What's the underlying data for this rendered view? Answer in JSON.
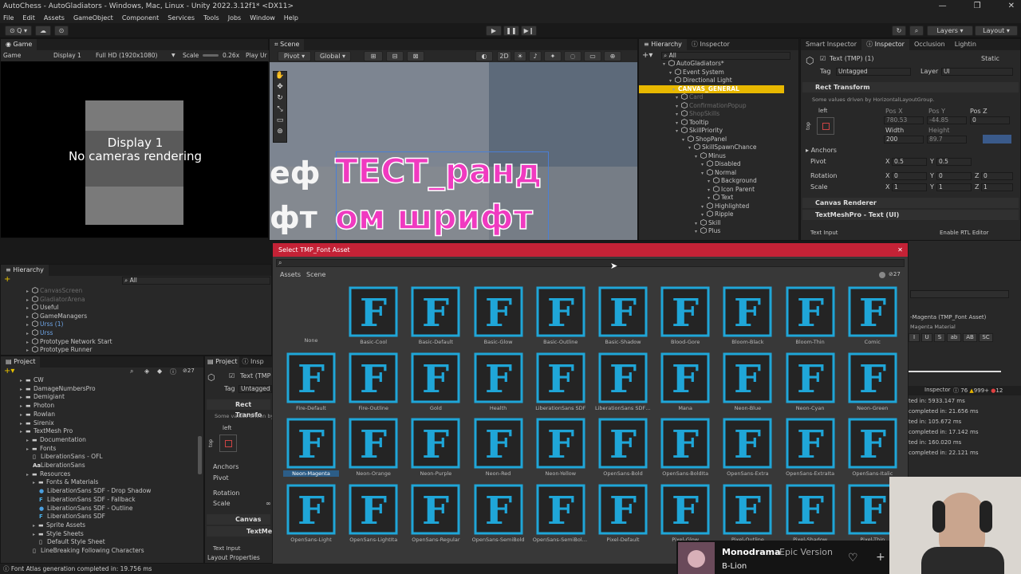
{
  "window": {
    "title": "AutoChess - AutoGladiators - Windows, Mac, Linux - Unity 2022.3.12f1* <DX11>",
    "menu": [
      "File",
      "Edit",
      "Assets",
      "GameObject",
      "Component",
      "Services",
      "Tools",
      "Jobs",
      "Window",
      "Help"
    ]
  },
  "toolbar": {
    "layers_label": "Layers",
    "layout_label": "Layout"
  },
  "game_view": {
    "tab": "Game",
    "mode": "Game",
    "display": "Display 1",
    "resolution": "Full HD (1920x1080)",
    "scale_label": "Scale",
    "scale_value": "0.26x",
    "play_label": "Play Ur",
    "overlay_line1": "Display 1",
    "overlay_line2": "No cameras rendering"
  },
  "scene_view": {
    "tab": "Scene",
    "pivot": "Pivot",
    "global": "Global",
    "mode_2d": "2D",
    "text_main_1": "ТЕСТ_ранд",
    "text_main_2": "ом шрифт",
    "text_left_1": "еф",
    "text_left_2": "фт"
  },
  "hierarchy_top": {
    "tabs": [
      "Hierarchy",
      "Inspector"
    ],
    "search_placeholder": "All",
    "items": [
      {
        "label": "AutoGladiators*",
        "indent": 0,
        "style": "normal"
      },
      {
        "label": "Event System",
        "indent": 1,
        "style": "normal"
      },
      {
        "label": "Directional Light",
        "indent": 1,
        "style": "normal"
      },
      {
        "label": "CANVAS_GENERAL",
        "indent": 1,
        "style": "highlight"
      },
      {
        "label": "Card",
        "indent": 2,
        "style": "dim"
      },
      {
        "label": "ConfirmationPopup",
        "indent": 2,
        "style": "dim"
      },
      {
        "label": "ShopSkills",
        "indent": 2,
        "style": "dim"
      },
      {
        "label": "Tooltip",
        "indent": 2,
        "style": "normal"
      },
      {
        "label": "SkillPriority",
        "indent": 2,
        "style": "normal"
      },
      {
        "label": "ShopPanel",
        "indent": 3,
        "style": "normal"
      },
      {
        "label": "SkillSpawnChance",
        "indent": 4,
        "style": "normal"
      },
      {
        "label": "Minus",
        "indent": 5,
        "style": "normal"
      },
      {
        "label": "Disabled",
        "indent": 6,
        "style": "normal"
      },
      {
        "label": "Normal",
        "indent": 6,
        "style": "normal"
      },
      {
        "label": "Background",
        "indent": 7,
        "style": "normal"
      },
      {
        "label": "Icon Parent",
        "indent": 7,
        "style": "normal"
      },
      {
        "label": "Text",
        "indent": 7,
        "style": "normal"
      },
      {
        "label": "Highlighted",
        "indent": 6,
        "style": "normal"
      },
      {
        "label": "Ripple",
        "indent": 6,
        "style": "normal"
      },
      {
        "label": "Skill",
        "indent": 5,
        "style": "normal"
      },
      {
        "label": "Plus",
        "indent": 5,
        "style": "normal"
      }
    ]
  },
  "inspector_right": {
    "tabs": [
      "Smart Inspector",
      "Inspector",
      "Occlusion",
      "Lightin"
    ],
    "object_name": "Text (TMP) (1)",
    "static_label": "Static",
    "tag_label": "Tag",
    "tag_value": "Untagged",
    "layer_label": "Layer",
    "layer_value": "UI",
    "rect_transform": "Rect Transform",
    "driven_note": "Some values driven by HorizontalLayoutGroup.",
    "left_label": "left",
    "top_label": "top",
    "posx_label": "Pos X",
    "posy_label": "Pos Y",
    "posz_label": "Pos Z",
    "posx": "780.53",
    "posy": "-44.85",
    "posz": "0",
    "width_label": "Width",
    "height_label": "Height",
    "width": "200",
    "height": "89.7",
    "anchors": "Anchors",
    "pivot": "Pivot",
    "pivot_x": "0.5",
    "pivot_y": "0.5",
    "rotation": "Rotation",
    "rot_x": "0",
    "rot_y": "0",
    "rot_z": "0",
    "scale": "Scale",
    "scale_x": "1",
    "scale_y": "1",
    "scale_z": "1",
    "canvas_renderer": "Canvas Renderer",
    "tmp_component": "TextMeshPro - Text (UI)",
    "text_input": "Text Input",
    "rtl": "Enable RTL Editor",
    "material_line1": "-Magenta (TMP_Font Asset)",
    "material_line2": "Magenta Material",
    "style_buttons": [
      "I",
      "U",
      "S",
      "ab",
      "AB",
      "SC"
    ]
  },
  "console": {
    "tab": "Inspector",
    "warn_count": "76",
    "err_count": "999+",
    "info_count": "12",
    "lines": [
      "ted in: 5933.147 ms",
      "completed in: 21.656 ms",
      "ted in: 105.672 ms",
      "completed in: 17.142 ms",
      "ted in: 160.020 ms",
      "completed in: 22.121 ms"
    ]
  },
  "hierarchy_left": {
    "tab": "Hierarchy",
    "search_placeholder": "All",
    "items": [
      {
        "label": "CanvasScreen",
        "style": "dim"
      },
      {
        "label": "GladiatorArena",
        "style": "dim"
      },
      {
        "label": "Useful",
        "style": "normal"
      },
      {
        "label": "GameManagers",
        "style": "normal"
      },
      {
        "label": "Urss (1)",
        "style": "blue"
      },
      {
        "label": "Urss",
        "style": "blue"
      },
      {
        "label": "Prototype Network Start",
        "style": "normal"
      },
      {
        "label": "Prototype Runner",
        "style": "normal"
      }
    ]
  },
  "project": {
    "tabs": [
      "Project",
      "Insp"
    ],
    "badge": "27",
    "items": [
      {
        "label": "CW",
        "indent": 1,
        "kind": "folder"
      },
      {
        "label": "DamageNumbersPro",
        "indent": 1,
        "kind": "folder"
      },
      {
        "label": "Demigiant",
        "indent": 1,
        "kind": "folder"
      },
      {
        "label": "Photon",
        "indent": 1,
        "kind": "folder"
      },
      {
        "label": "Rowlan",
        "indent": 1,
        "kind": "folder"
      },
      {
        "label": "Sirenix",
        "indent": 1,
        "kind": "folder"
      },
      {
        "label": "TextMesh Pro",
        "indent": 1,
        "kind": "folder"
      },
      {
        "label": "Documentation",
        "indent": 2,
        "kind": "folder"
      },
      {
        "label": "Fonts",
        "indent": 2,
        "kind": "folder"
      },
      {
        "label": "LiberationSans - OFL",
        "indent": 3,
        "kind": "file"
      },
      {
        "label": "LiberationSans",
        "indent": 3,
        "kind": "font"
      },
      {
        "label": "Resources",
        "indent": 2,
        "kind": "folder"
      },
      {
        "label": "Fonts & Materials",
        "indent": 3,
        "kind": "folder"
      },
      {
        "label": "LiberationSans SDF - Drop Shadow",
        "indent": 4,
        "kind": "mat"
      },
      {
        "label": "LiberationSans SDF - Fallback",
        "indent": 4,
        "kind": "fasset"
      },
      {
        "label": "LiberationSans SDF - Outline",
        "indent": 4,
        "kind": "mat"
      },
      {
        "label": "LiberationSans SDF",
        "indent": 4,
        "kind": "fasset"
      },
      {
        "label": "Sprite Assets",
        "indent": 3,
        "kind": "folder"
      },
      {
        "label": "Style Sheets",
        "indent": 3,
        "kind": "folder"
      },
      {
        "label": "Default Style Sheet",
        "indent": 4,
        "kind": "file"
      },
      {
        "label": "LineBreaking Following Characters",
        "indent": 3,
        "kind": "file"
      }
    ]
  },
  "inspector_mini": {
    "object_name": "Text (TMP",
    "tag_label": "Tag",
    "tag_value": "Untagged",
    "rect": "Rect Transfo",
    "driven": "Some values driven by",
    "left": "left",
    "top": "top",
    "anchors": "Anchors",
    "pivot": "Pivot",
    "rotation": "Rotation",
    "scale": "Scale",
    "canvas": "Canvas Rend",
    "tmp": "TextMeshPr",
    "text_input": "Text Input",
    "layout_props": "Layout Properties"
  },
  "picker": {
    "title": "Select TMP_Font Asset",
    "tabs": [
      "Assets",
      "Scene"
    ],
    "count": "27",
    "none_label": "None",
    "fonts": [
      "Basic-Cool",
      "Basic-Default",
      "Basic-Glow",
      "Basic-Outline",
      "Basic-Shadow",
      "Blood-Gore",
      "Bloom-Black",
      "Bloom-Thin",
      "Comic",
      "Fire-Default",
      "Fire-Outline",
      "Gold",
      "Health",
      "LiberationSans SDF",
      "LiberationSans SDF - Fallback",
      "Mana",
      "Neon-Blue",
      "Neon-Cyan",
      "Neon-Green",
      "Neon-Magenta",
      "Neon-Orange",
      "Neon-Purple",
      "Neon-Red",
      "Neon-Yellow",
      "OpenSans-Bold",
      "OpenSans-BoldIta",
      "OpenSans-Extra",
      "OpenSans-ExtraIta",
      "OpenSans-Italic",
      "OpenSans-Light",
      "OpenSans-LightIta",
      "OpenSans-Regular",
      "OpenSans-SemiBold",
      "OpenSans-SemiBoldIta",
      "Pixel-Default",
      "Pixel-Glow",
      "Pixel-Outline",
      "Pixel-Shadow",
      "Pixel-Thin"
    ],
    "selected": "Neon-Magenta",
    "icon_color": "#1fa6d8"
  },
  "status_bar": {
    "text": "Font Atlas generation completed in: 19.756 ms"
  },
  "music": {
    "title": "Monodrama",
    "subtitle": "Epic Version",
    "artist": "B-Lion"
  }
}
